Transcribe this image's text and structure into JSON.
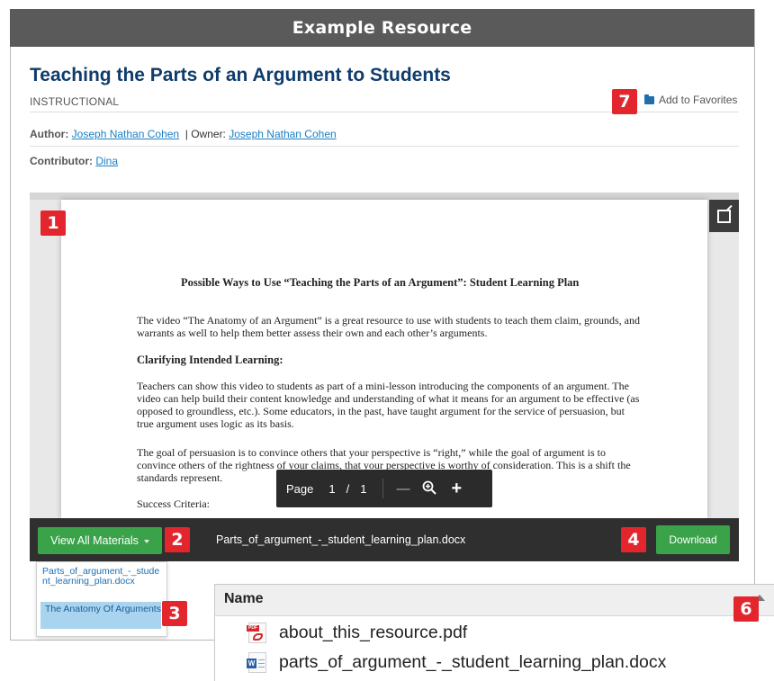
{
  "banner": {
    "title": "Example Resource"
  },
  "resource": {
    "title": "Teaching the Parts of an Argument to Students",
    "category": "INSTRUCTIONAL",
    "add_favorites": "Add to Favorites",
    "author_label": "Author:",
    "author_name": "Joseph Nathan Cohen",
    "owner_sep": "| Owner:",
    "owner_name": "Joseph Nathan Cohen",
    "contributor_label": "Contributor:",
    "contributor_name": "Dina"
  },
  "document": {
    "title": "Possible Ways to Use “Teaching the Parts of an Argument”: Student Learning Plan",
    "para1": "The video “The Anatomy of an Argument” is a great resource to use with students to teach them claim, grounds, and warrants as well to help them better assess their own and each other’s arguments.",
    "heading1": "Clarifying Intended Learning:",
    "para2": "Teachers can show this video to students as part of a mini-lesson introducing the components of an argument.  The video can help build their content knowledge and understanding of what it means for an argument to be effective (as opposed to groundless, etc.). Some educators, in the past, have taught argument for the service of persuasion, but true argument uses logic as its basis.",
    "para3": "The goal of persuasion is to convince others that your perspective is “right,” while the goal of argument is to convince others of the rightness of your claims, that your perspective is worthy of consideration.  This is a shift the standards represent.",
    "para4": "Success Criteria:"
  },
  "pager": {
    "label": "Page",
    "current": "1",
    "sep": "/",
    "total": "1",
    "minus": "—",
    "plus": "+"
  },
  "toolbar": {
    "view_all": "View All Materials",
    "filename": "Parts_of_argument_-_student_learning_plan.docx",
    "download": "Download"
  },
  "dropdown": {
    "items": [
      "Parts_of_argument_-_student_learning_plan.docx",
      "The Anatomy Of Arguments"
    ]
  },
  "badges": [
    "1",
    "2",
    "3",
    "4",
    "6",
    "7"
  ],
  "finder": {
    "column_name": "Name",
    "files": [
      "about_this_resource.pdf",
      "parts_of_argument_-_student_learning_plan.docx"
    ]
  },
  "colors": {
    "accent_green": "#3aa34a",
    "title_blue": "#0f3c6a",
    "link_blue": "#1b7fc4",
    "badge_red": "#e3262d"
  }
}
